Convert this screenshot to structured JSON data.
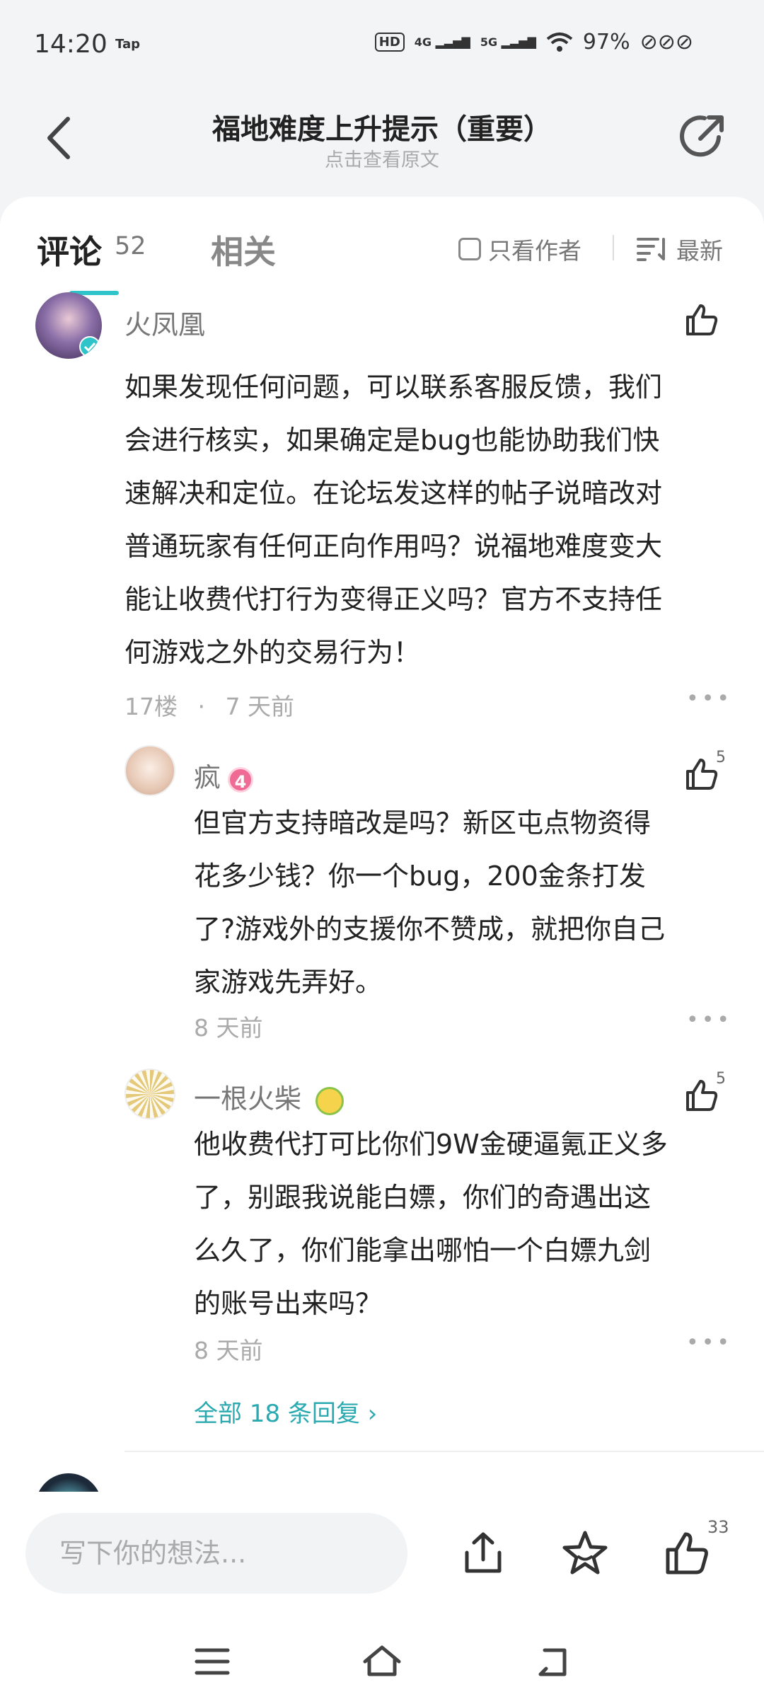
{
  "status_bar": {
    "time": "14:20",
    "tap_label": "Tap",
    "hd_label": "HD",
    "net1": "4G",
    "net2": "5G",
    "battery": "97%"
  },
  "header": {
    "title": "福地难度上升提示（重要）",
    "subtitle": "点击查看原文"
  },
  "tabs": {
    "comments_label": "评论",
    "comments_count": "52",
    "related_label": "相关",
    "author_only_label": "只看作者",
    "sort_label": "最新"
  },
  "comment": {
    "author": "火凤凰",
    "text_lines": [
      "如果发现任何问题，可以联系客服反馈，我们",
      "会进行核实，如果确定是bug也能协助我们快",
      "速解决和定位。在论坛发这样的帖子说暗改对",
      "普通玩家有任何正向作用吗？说福地难度变大",
      "能让收费代打行为变得正义吗？官方不支持任",
      "何游戏之外的交易行为！"
    ],
    "floor": "17楼",
    "dot": "·",
    "time": "7 天前"
  },
  "replies": [
    {
      "author": "疯",
      "level": "4",
      "likes": "5",
      "text_lines": [
        "但官方支持暗改是吗？新区屯点物资得",
        "花多少钱？你一个bug，200金条打发",
        "了?游戏外的支援你不赞成，就把你自己",
        "家游戏先弄好。"
      ],
      "time": "8 天前"
    },
    {
      "author": "一根火柴",
      "likes": "5",
      "text_lines": [
        "他收费代打可比你们9W金硬逼氪正义多",
        "了，别跟我说能白嫖，你们的奇遇出这",
        "么久了，你们能拿出哪怕一个白嫖九剑",
        "的账号出来吗？"
      ],
      "time": "8 天前"
    }
  ],
  "all_replies_label": "全部 18 条回复 ›",
  "bottom_bar": {
    "input_placeholder": "写下你的想法...",
    "like_count": "33"
  },
  "colors": {
    "accent": "#2aa9b0",
    "level_badge": "#f06a96"
  }
}
